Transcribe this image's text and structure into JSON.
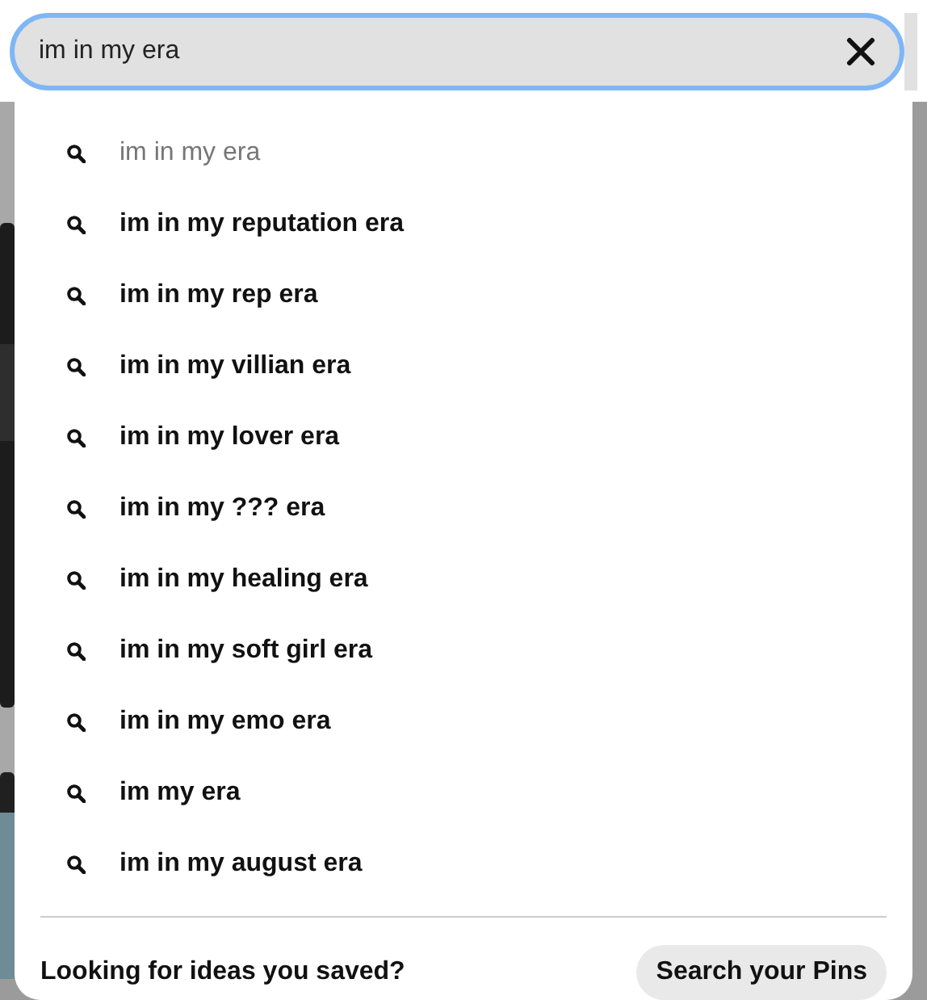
{
  "search": {
    "value": "im in my era"
  },
  "suggestions": [
    {
      "kind": "typed",
      "label": "im in my era"
    },
    {
      "kind": "suggested",
      "label": "im in my reputation era"
    },
    {
      "kind": "suggested",
      "label": "im in my rep era"
    },
    {
      "kind": "suggested",
      "label": "im in my villian era"
    },
    {
      "kind": "suggested",
      "label": "im in my lover era"
    },
    {
      "kind": "suggested",
      "label": "im in my ??? era"
    },
    {
      "kind": "suggested",
      "label": "im in my healing era"
    },
    {
      "kind": "suggested",
      "label": "im in my soft girl era"
    },
    {
      "kind": "suggested",
      "label": "im in my emo era"
    },
    {
      "kind": "suggested",
      "label": "im my era"
    },
    {
      "kind": "suggested",
      "label": "im in my august era"
    }
  ],
  "footer": {
    "text": "Looking for ideas you saved?",
    "button": "Search your Pins"
  }
}
